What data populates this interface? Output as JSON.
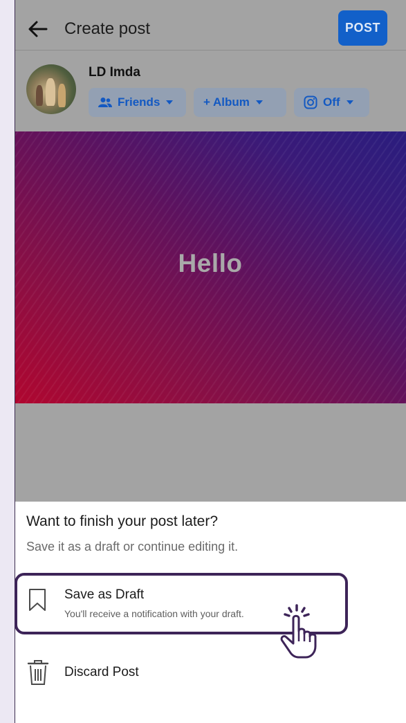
{
  "header": {
    "title": "Create post",
    "post_label": "POST"
  },
  "author": {
    "name": "LD Imda",
    "audience_label": "Friends",
    "album_label": "+ Album",
    "instagram_label": "Off"
  },
  "card": {
    "text": "Hello"
  },
  "sheet": {
    "title": "Want to finish your post later?",
    "subtitle": "Save it as a draft or continue editing it.",
    "options": [
      {
        "label": "Save as Draft",
        "description": "You'll receive a notification with your draft.",
        "icon": "bookmark-icon"
      },
      {
        "label": "Discard Post",
        "icon": "trash-icon"
      }
    ]
  },
  "colors": {
    "accent": "#1260c9",
    "highlight": "#3d2458",
    "dim_overlay": "#a3a3a3"
  }
}
